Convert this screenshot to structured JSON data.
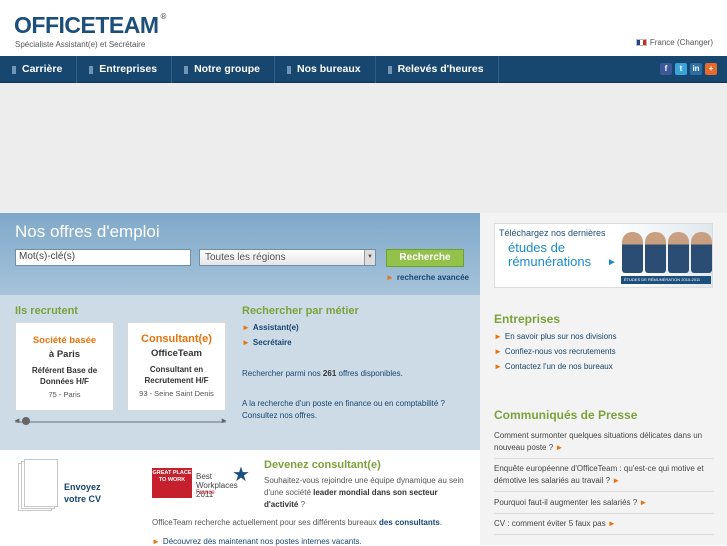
{
  "header": {
    "logo": "OFFICETEAM",
    "logo_reg": "®",
    "tagline": "Spécialiste Assistant(e) et Secrétaire",
    "country": "France (Changer)"
  },
  "nav": {
    "items": [
      {
        "label": "Carrière"
      },
      {
        "label": "Entreprises"
      },
      {
        "label": "Notre groupe"
      },
      {
        "label": "Nos bureaux"
      },
      {
        "label": "Relevés d'heures"
      }
    ],
    "social": [
      {
        "icon": "facebook-icon",
        "glyph": "f",
        "color": "#3b5998"
      },
      {
        "icon": "twitter-icon",
        "glyph": "t",
        "color": "#3aa3d8"
      },
      {
        "icon": "linkedin-icon",
        "glyph": "in",
        "color": "#2b6ea8"
      },
      {
        "icon": "share-icon",
        "glyph": "+",
        "color": "#e86b2b"
      }
    ]
  },
  "search": {
    "title": "Nos offres d'emploi",
    "keyword_placeholder": "Mot(s)-clé(s)",
    "region_selected": "Toutes les régions",
    "button": "Recherche",
    "advanced": "recherche avancée"
  },
  "ad": {
    "line1": "Téléchargez nos dernières",
    "line2": "études de",
    "line3": "rémunérations",
    "strip": "ÉTUDES DE RÉMUNÉRATION 2010-2011"
  },
  "recruiters": {
    "title": "Ils recrutent",
    "cards": [
      {
        "k1": "Société basée",
        "k2": "à Paris",
        "k3": "Référent Base de Données H/F",
        "k4": "75 - Paris"
      },
      {
        "k1": "Consultant(e)",
        "k2": "OfficeTeam",
        "k3": "Consultant en Recrutement H/F",
        "k4": "93 - Seine Saint Denis"
      }
    ]
  },
  "metier": {
    "title": "Rechercher par métier",
    "links": [
      "Assistant(e)",
      "Secrétaire"
    ],
    "search_pre": "Rechercher parmi nos ",
    "count": "261",
    "search_post": " offres disponibles.",
    "finance_text": "A la recherche d'un poste en finance ou en comptabilité ?",
    "finance_link": "Consultez nos offres."
  },
  "cv": {
    "label1": "Envoyez",
    "label2": "votre CV"
  },
  "gptw": {
    "box": "GREAT PLACE TO WORK",
    "text": "Best Workplaces 2011",
    "sub": "France"
  },
  "consultant": {
    "title": "Devenez consultant(e)",
    "text_pre": "Souhaitez-vous rejoindre une équipe dynamique au sein d'une société ",
    "text_bold": "leader mondial dans son secteur d'activité",
    "text_post": " ?",
    "recherche_pre": "OfficeTeam recherche actuellement pour ses différents bureaux ",
    "recherche_bold": "des consultants",
    "recherche_post": ".",
    "decouvrez": "Découvrez dès maintenant nos postes internes vacants."
  },
  "entreprises": {
    "title": "Entreprises",
    "links": [
      "En savoir plus sur nos divisions",
      "Confiez-nous vos recrutements",
      "Contactez l'un de nos bureaux"
    ]
  },
  "presse": {
    "title": "Communiqués de Presse",
    "items": [
      "Comment surmonter quelques situations délicates dans un nouveau poste ?",
      "Enquête européenne d'OfficeTeam : qu'est-ce qui motive et démotive les salariés au travail ?",
      "Pourquoi faut-il augmenter les salariés ?",
      "CV : comment éviter 5 faux pas"
    ]
  },
  "colors": {
    "nav": "#17466f",
    "accent_green": "#7ca23c",
    "accent_orange": "#e8730c",
    "search_bg": "#a6c3da"
  }
}
